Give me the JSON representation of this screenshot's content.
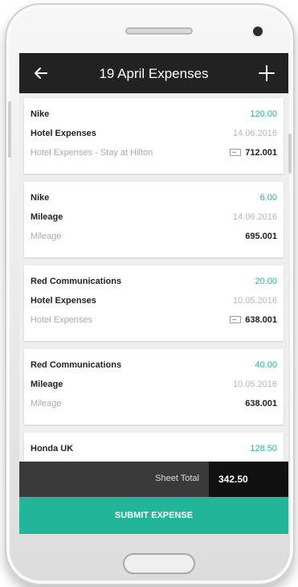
{
  "header": {
    "title": "19 April Expenses",
    "back_icon": "arrow-left-icon",
    "add_icon": "plus-icon"
  },
  "expenses": [
    {
      "company": "Nike",
      "amount": "120.00",
      "category": "Hotel Expenses",
      "date": "14.06.2016",
      "description": "Hotel Expenses - Stay at Hilton",
      "has_attachment": true,
      "reference": "712.001"
    },
    {
      "company": "Nike",
      "amount": "6.00",
      "category": "Mileage",
      "date": "14.06.2016",
      "description": "Mileage",
      "has_attachment": false,
      "reference": "695.001"
    },
    {
      "company": "Red Communications",
      "amount": "20.00",
      "category": "Hotel Expenses",
      "date": "10.05.2016",
      "description": "Hotel Expenses",
      "has_attachment": true,
      "reference": "638.001"
    },
    {
      "company": "Red Communications",
      "amount": "40.00",
      "category": "Mileage",
      "date": "10.05.2016",
      "description": "Mileage",
      "has_attachment": false,
      "reference": "638.001"
    },
    {
      "company": "Honda UK",
      "amount": "128.50"
    }
  ],
  "footer": {
    "total_label": "Sheet Total",
    "total_value": "342.50",
    "submit_label": "SUBMIT EXPENSE"
  },
  "colors": {
    "accent": "#22b59a",
    "appbar": "#222222",
    "total_bar": "#3a3a3a"
  }
}
